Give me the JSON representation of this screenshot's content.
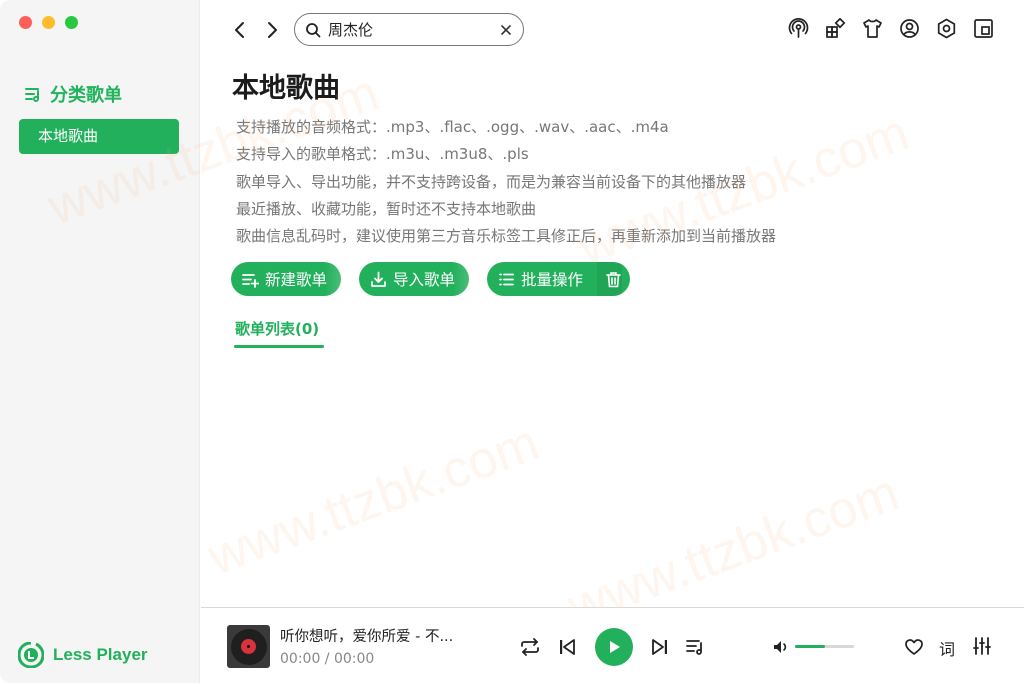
{
  "sidebar": {
    "section_title": "分类歌单",
    "items": [
      {
        "label": "本地歌曲",
        "active": true
      }
    ],
    "brand": "Less Player"
  },
  "topbar": {
    "search_value": "周杰伦",
    "icons": [
      "podcast-icon",
      "apps-icon",
      "shirt-icon",
      "user-icon",
      "settings-icon",
      "miniplayer-icon"
    ]
  },
  "main": {
    "title": "本地歌曲",
    "info_lines": [
      "支持播放的音频格式：.mp3、.flac、.ogg、.wav、.aac、.m4a",
      "支持导入的歌单格式：.m3u、.m3u8、.pls",
      "歌单导入、导出功能，并不支持跨设备，而是为兼容当前设备下的其他播放器",
      "最近播放、收藏功能，暂时还不支持本地歌曲",
      "歌曲信息乱码时，建议使用第三方音乐标签工具修正后，再重新添加到当前播放器"
    ],
    "buttons": {
      "new_playlist": "新建歌单",
      "import_playlist": "导入歌单",
      "batch": "批量操作"
    },
    "tab_label": "歌单列表(0)"
  },
  "player": {
    "song_title": "听你想听，爱你所爱 - 不...",
    "time": "00:00 / 00:00",
    "volume": 0.5,
    "lyric_label": "词"
  },
  "colors": {
    "accent": "#23b05c",
    "sidebar_bg": "#f5f5f5"
  },
  "watermark": "www.ttzbk.com"
}
